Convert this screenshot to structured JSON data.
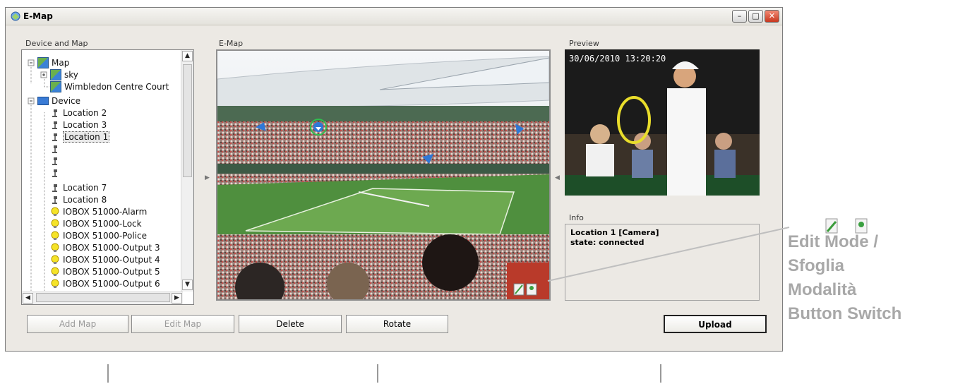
{
  "window": {
    "title": "E-Map",
    "controls": {
      "minimize": "–",
      "maximize": "□",
      "close": "✕"
    }
  },
  "panels": {
    "device_and_map": "Device and Map",
    "emap": "E-Map",
    "preview": "Preview",
    "info": "Info"
  },
  "tree": {
    "map_root": "Map",
    "sky": "sky",
    "wimbledon": "Wimbledon Centre Court",
    "device_root": "Device",
    "location2": "Location 2",
    "location3": "Location 3",
    "location1": "Location 1",
    "location7": "Location 7",
    "location8": "Location 8",
    "alarm": "IOBOX 51000-Alarm",
    "lock": "IOBOX 51000-Lock",
    "police": "IOBOX 51000-Police",
    "output3": "IOBOX 51000-Output 3",
    "output4": "IOBOX 51000-Output 4",
    "output5": "IOBOX 51000-Output 5",
    "output6": "IOBOX 51000-Output 6"
  },
  "preview": {
    "timestamp": "30/06/2010   13:20:20"
  },
  "info": {
    "line1": "Location 1 [Camera]",
    "line2": "state: connected"
  },
  "buttons": {
    "add_map": "Add Map",
    "edit_map": "Edit Map",
    "delete": "Delete",
    "rotate": "Rotate",
    "upload": "Upload"
  },
  "callout": {
    "line1": "Edit Mode /",
    "line2": "Sfoglia",
    "line3": "Modalità",
    "line4": "Button Switch"
  },
  "colors": {
    "window_bg": "#ece9e4",
    "callout_text": "#a8a8a8",
    "camera_marker": "#2f78d6",
    "selected_marker_ring": "#2fbf4f"
  }
}
